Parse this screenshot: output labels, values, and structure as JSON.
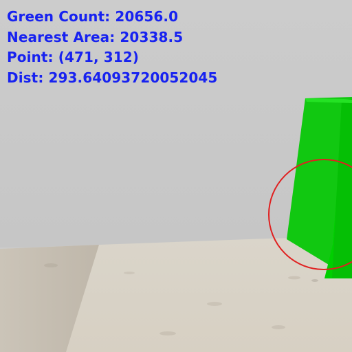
{
  "hud": {
    "green_count": "Green Count: 20656.0",
    "nearest_area": "Nearest Area: 20338.5",
    "point": "Point: (471, 312)",
    "dist": "Dist: 293.64093720052045"
  },
  "colors": {
    "hud_text": "#1722f0",
    "wall": "#cbcbcb",
    "floor_light": "#d8d2c4",
    "floor_shadow": "#c8c0b3",
    "box_green": "#16d816",
    "box_dark": "#10ba10",
    "circle": "#e02020"
  }
}
